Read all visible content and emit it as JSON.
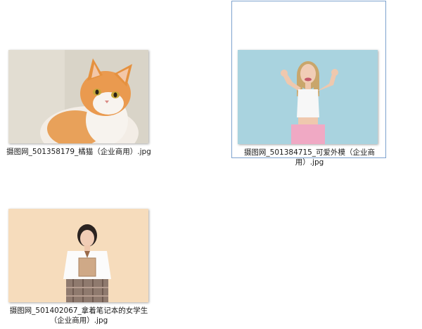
{
  "files": [
    {
      "name": "摄图网_501358179_橘猫（企业商用）.jpg",
      "selected": false,
      "thumbnail": "orange-cat-photo"
    },
    {
      "name": "摄图网_501384715_可爱外模（企业商用）.jpg",
      "selected": true,
      "thumbnail": "smiling-woman-photo"
    },
    {
      "name": "摄图网_501402067_拿着笔记本的女学生（企业商用）.jpg",
      "selected": false,
      "thumbnail": "schoolgirl-notebook-photo"
    }
  ],
  "colors": {
    "selection_border": "#7da2ce",
    "cat_background": "#d9d4c8",
    "model_background": "#a9d3df",
    "student_background": "#f6dcbc"
  }
}
